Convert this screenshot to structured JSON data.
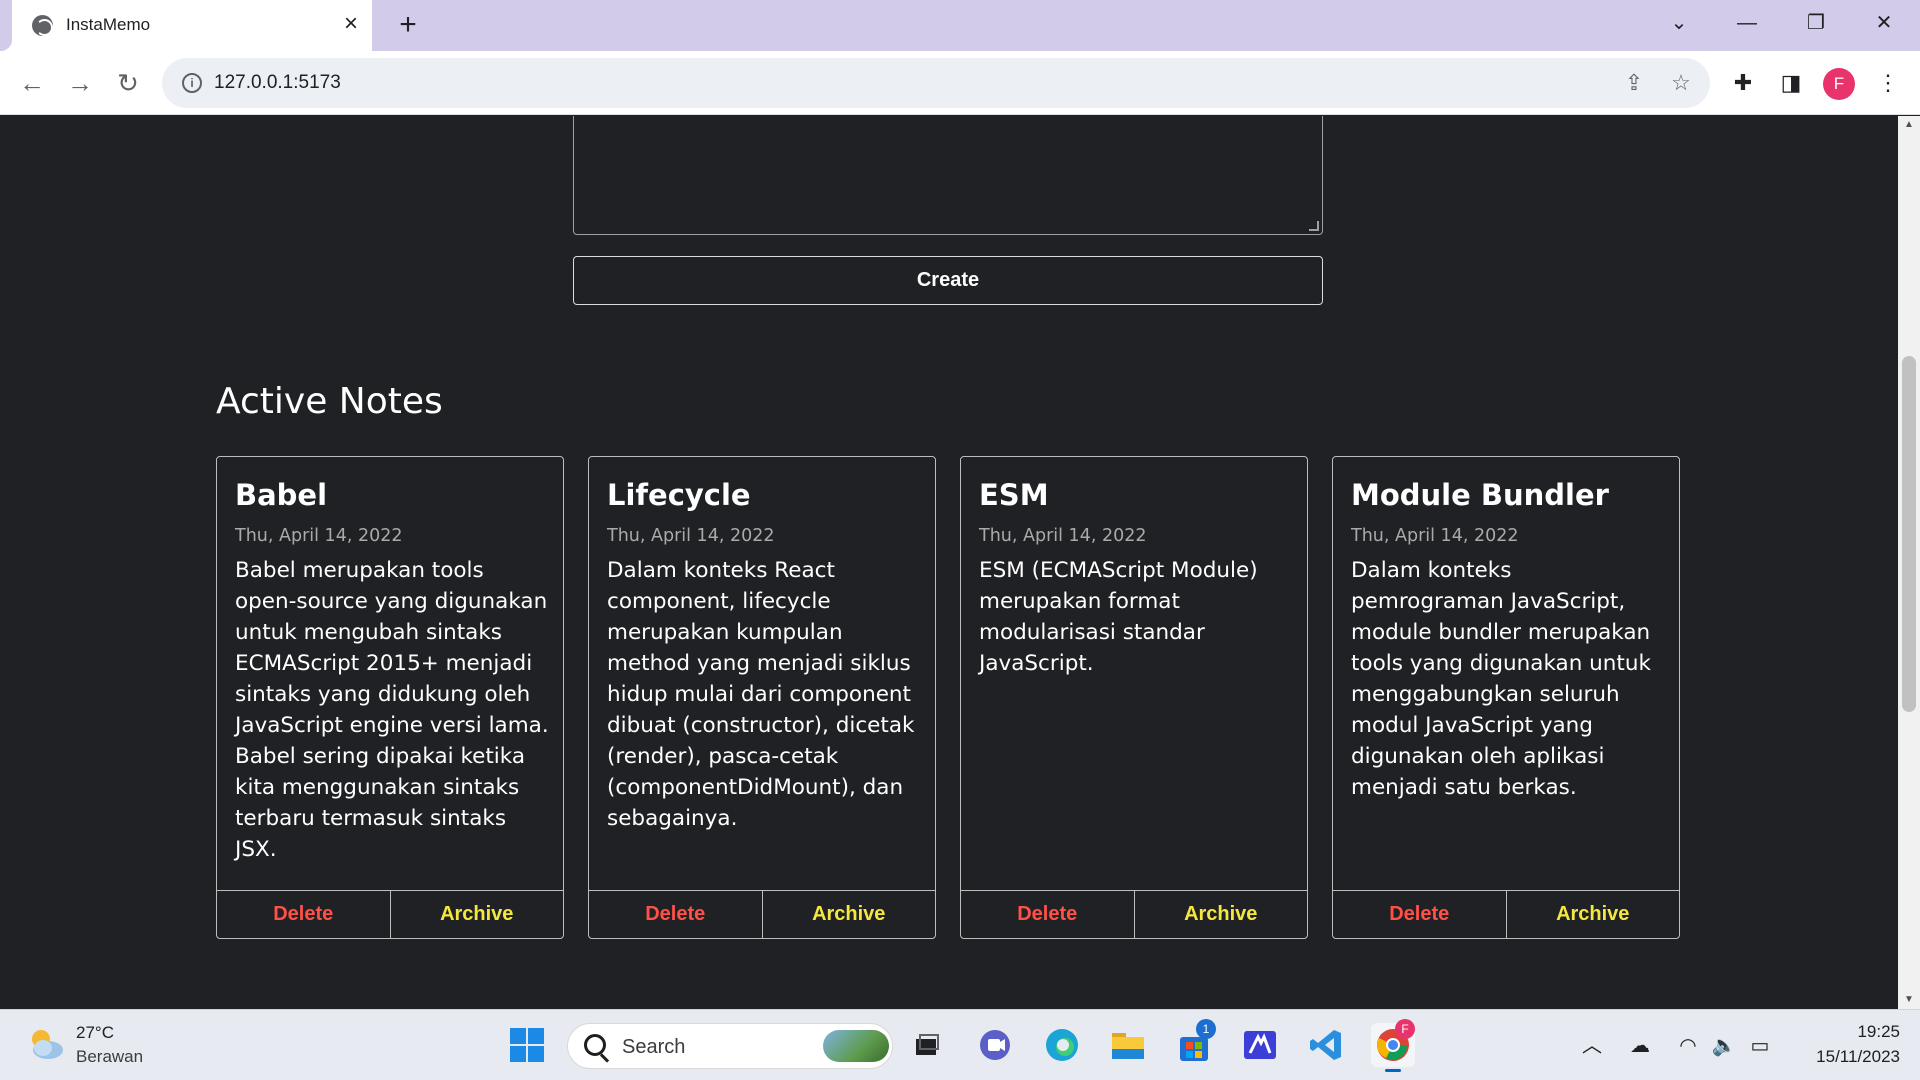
{
  "browser": {
    "tab_title": "InstaMemo",
    "url": "127.0.0.1:5173",
    "profile_initial": "F"
  },
  "form": {
    "create_label": "Create"
  },
  "section": {
    "title": "Active Notes"
  },
  "notes": [
    {
      "title": "Babel",
      "date": "Thu, April 14, 2022",
      "body": "Babel merupakan tools open-source yang digunakan untuk mengubah sintaks ECMAScript 2015+ menjadi sintaks yang didukung oleh JavaScript engine versi lama. Babel sering dipakai ketika kita menggunakan sintaks terbaru termasuk sintaks JSX.",
      "delete_label": "Delete",
      "archive_label": "Archive"
    },
    {
      "title": "Lifecycle",
      "date": "Thu, April 14, 2022",
      "body": "Dalam konteks React component, lifecycle merupakan kumpulan method yang menjadi siklus hidup mulai dari component dibuat (constructor), dicetak (render), pasca-cetak (componentDidMount), dan sebagainya.",
      "delete_label": "Delete",
      "archive_label": "Archive"
    },
    {
      "title": "ESM",
      "date": "Thu, April 14, 2022",
      "body": "ESM (ECMAScript Module) merupakan format modularisasi standar JavaScript.",
      "delete_label": "Delete",
      "archive_label": "Archive"
    },
    {
      "title": "Module Bundler",
      "date": "Thu, April 14, 2022",
      "body": "Dalam konteks pemrograman JavaScript, module bundler merupakan tools yang digunakan untuk menggabungkan seluruh modul JavaScript yang digunakan oleh aplikasi menjadi satu berkas.",
      "delete_label": "Delete",
      "archive_label": "Archive"
    }
  ],
  "taskbar": {
    "weather_temp": "27°C",
    "weather_desc": "Berawan",
    "search_label": "Search",
    "store_badge": "1",
    "chrome_badge": "F",
    "time": "19:25",
    "date": "15/11/2023"
  },
  "colors": {
    "page_bg": "#202124",
    "delete": "#ff5148",
    "archive": "#f3e740",
    "tab_strip": "#d3cbea"
  }
}
